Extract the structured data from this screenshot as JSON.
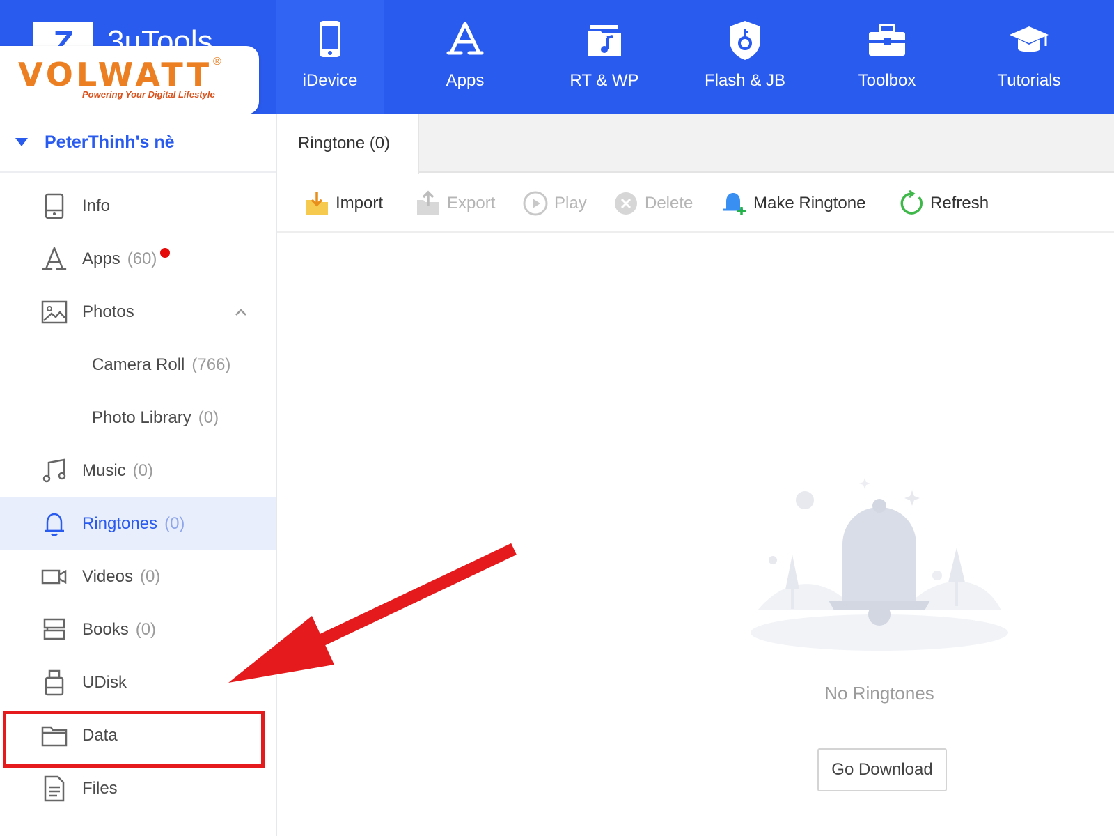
{
  "app": {
    "logo_glyph": "Z",
    "name": "3uTools"
  },
  "watermark": {
    "brand": "VOLWATT",
    "registered": "®",
    "tagline": "Powering Your Digital Lifestyle"
  },
  "nav": {
    "tabs": [
      {
        "label": "iDevice",
        "icon": "phone-icon",
        "active": true
      },
      {
        "label": "Apps",
        "icon": "app-store-icon",
        "active": false
      },
      {
        "label": "RT & WP",
        "icon": "music-folder-icon",
        "active": false
      },
      {
        "label": "Flash & JB",
        "icon": "shield-key-icon",
        "active": false
      },
      {
        "label": "Toolbox",
        "icon": "toolbox-icon",
        "active": false
      },
      {
        "label": "Tutorials",
        "icon": "graduation-cap-icon",
        "active": false
      }
    ]
  },
  "sidebar": {
    "device_name": "PeterThinh's nè",
    "items": [
      {
        "label": "Info",
        "count": "",
        "icon": "device-info-icon"
      },
      {
        "label": "Apps",
        "count": "(60)",
        "icon": "app-store-icon",
        "notification_dot": true
      },
      {
        "label": "Photos",
        "count": "",
        "icon": "photo-icon",
        "expanded": true
      },
      {
        "label": "Camera Roll",
        "count": "(766)",
        "sub": true
      },
      {
        "label": "Photo Library",
        "count": "(0)",
        "sub": true
      },
      {
        "label": "Music",
        "count": "(0)",
        "icon": "music-note-icon"
      },
      {
        "label": "Ringtones",
        "count": "(0)",
        "icon": "bell-icon",
        "active": true
      },
      {
        "label": "Videos",
        "count": "(0)",
        "icon": "video-camera-icon"
      },
      {
        "label": "Books",
        "count": "(0)",
        "icon": "book-icon"
      },
      {
        "label": "UDisk",
        "count": "",
        "icon": "usb-drive-icon"
      },
      {
        "label": "Data",
        "count": "",
        "icon": "folder-icon",
        "highlighted": true
      },
      {
        "label": "Files",
        "count": "",
        "icon": "file-icon"
      }
    ]
  },
  "main": {
    "tab_label": "Ringtone (0)",
    "toolbar": {
      "import": "Import",
      "export": "Export",
      "play": "Play",
      "delete": "Delete",
      "make_ringtone": "Make Ringtone",
      "refresh": "Refresh"
    },
    "empty_text": "No Ringtones",
    "go_download": "Go Download"
  },
  "colors": {
    "brand_blue": "#2a5bef",
    "highlight_red": "#e41a1c",
    "watermark_orange": "#ec7f22"
  }
}
